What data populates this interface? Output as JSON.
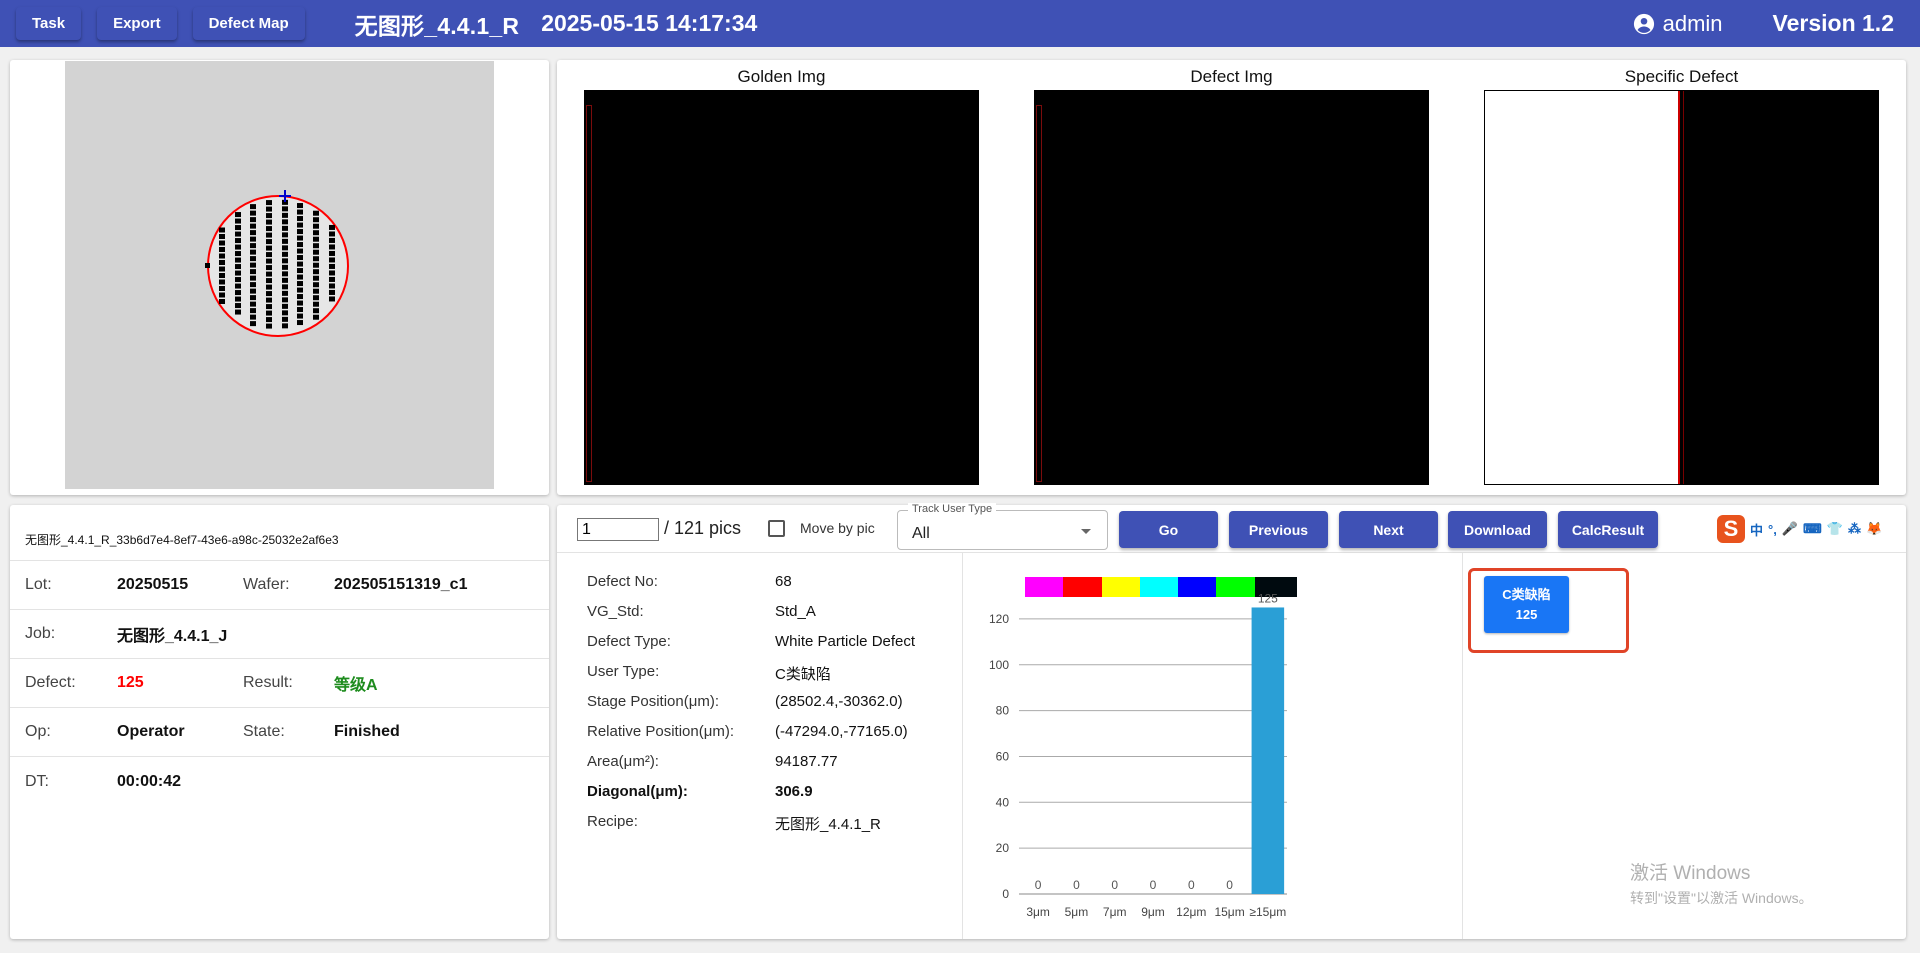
{
  "topbar": {
    "buttons": [
      "Task",
      "Export",
      "Defect Map"
    ],
    "title": "无图形_4.4.1_R",
    "datetime": "2025-05-15 14:17:34",
    "user": "admin",
    "version": "Version 1.2"
  },
  "images": {
    "golden_title": "Golden Img",
    "defect_title": "Defect Img",
    "specific_title": "Specific Defect"
  },
  "info": {
    "id": "无图形_4.4.1_R_33b6d7e4-8ef7-43e6-a98c-25032e2af6e3",
    "lot_label": "Lot:",
    "lot": "20250515",
    "wafer_label": "Wafer:",
    "wafer": "202505151319_c1",
    "job_label": "Job:",
    "job": "无图形_4.4.1_J",
    "defect_label": "Defect:",
    "defect": "125",
    "result_label": "Result:",
    "result": "等级A",
    "op_label": "Op:",
    "op": "Operator",
    "state_label": "State:",
    "state": "Finished",
    "dt_label": "DT:",
    "dt": "00:00:42",
    "defect_color": "#ff0000",
    "result_color": "#1e8c1e"
  },
  "controls": {
    "page_value": "1",
    "page_total": "/ 121 pics",
    "move_by_pic": "Move by pic",
    "track_user_type_label": "Track User Type",
    "track_user_type_value": "All",
    "buttons": [
      "Go",
      "Previous",
      "Next",
      "Download",
      "CalcResult"
    ],
    "ime_items": [
      "中",
      "°,",
      "🎤",
      "⌨",
      "👕",
      "⁂",
      "🦊"
    ]
  },
  "defect": {
    "rows": [
      {
        "k": "Defect No:",
        "v": "68",
        "bold": false
      },
      {
        "k": "VG_Std:",
        "v": "Std_A",
        "bold": false
      },
      {
        "k": "Defect Type:",
        "v": "White Particle Defect",
        "bold": false
      },
      {
        "k": "User Type:",
        "v": "C类缺陷",
        "bold": false
      },
      {
        "k": "Stage Position(μm):",
        "v": "(28502.4,-30362.0)",
        "bold": false
      },
      {
        "k": "Relative Position(μm):",
        "v": "(-47294.0,-77165.0)",
        "bold": false
      },
      {
        "k": "Area(μm²):",
        "v": "94187.77",
        "bold": false
      },
      {
        "k": "Diagonal(μm):",
        "v": "306.9",
        "bold": true
      },
      {
        "k": "Recipe:",
        "v": "无图形_4.4.1_R",
        "bold": false
      }
    ]
  },
  "chart_data": {
    "type": "bar",
    "categories": [
      "3μm",
      "5μm",
      "7μm",
      "9μm",
      "12μm",
      "15μm",
      "≥15μm"
    ],
    "values": [
      0,
      0,
      0,
      0,
      0,
      0,
      125
    ],
    "legend_colors": [
      "#ff00ff",
      "#ff0000",
      "#ffff00",
      "#00ffff",
      "#0000ff",
      "#00ff00",
      "#000a0f"
    ],
    "bar_color": "#2a9fd6",
    "ylim": [
      0,
      130
    ],
    "yticks": [
      0,
      20,
      40,
      60,
      80,
      100,
      120
    ],
    "grid": true
  },
  "category": {
    "name": "C类缺陷",
    "count": "125"
  },
  "watermark": {
    "line1": "激活 Windows",
    "line2": "转到\"设置\"以激活 Windows。"
  }
}
